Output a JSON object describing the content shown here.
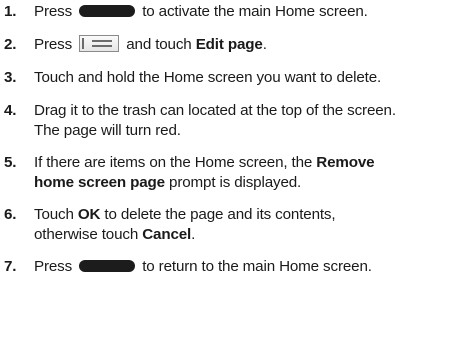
{
  "steps": [
    {
      "num": "1.",
      "before": "Press",
      "after": "to activate the main Home screen.",
      "icon": "home-key-icon"
    },
    {
      "num": "2.",
      "before": "Press",
      "middle": "and touch",
      "bold": "Edit page",
      "end": ".",
      "icon": "menu-key-icon"
    },
    {
      "num": "3.",
      "text": "Touch and hold the Home screen you want to delete."
    },
    {
      "num": "4.",
      "line1": "Drag it to the trash can located at the top of the screen.",
      "line2": "The page will turn red."
    },
    {
      "num": "5.",
      "before": "If there are items on the Home screen, the",
      "bold1": "Remove",
      "bold2": "home screen page",
      "after": "prompt is displayed."
    },
    {
      "num": "6.",
      "before": "Touch",
      "bold1": "OK",
      "middle": "to delete the page and its contents,",
      "line2_before": "otherwise touch",
      "bold2": "Cancel",
      "end": "."
    },
    {
      "num": "7.",
      "before": "Press",
      "after": "to return to the main Home screen.",
      "icon": "home-key-icon"
    }
  ]
}
